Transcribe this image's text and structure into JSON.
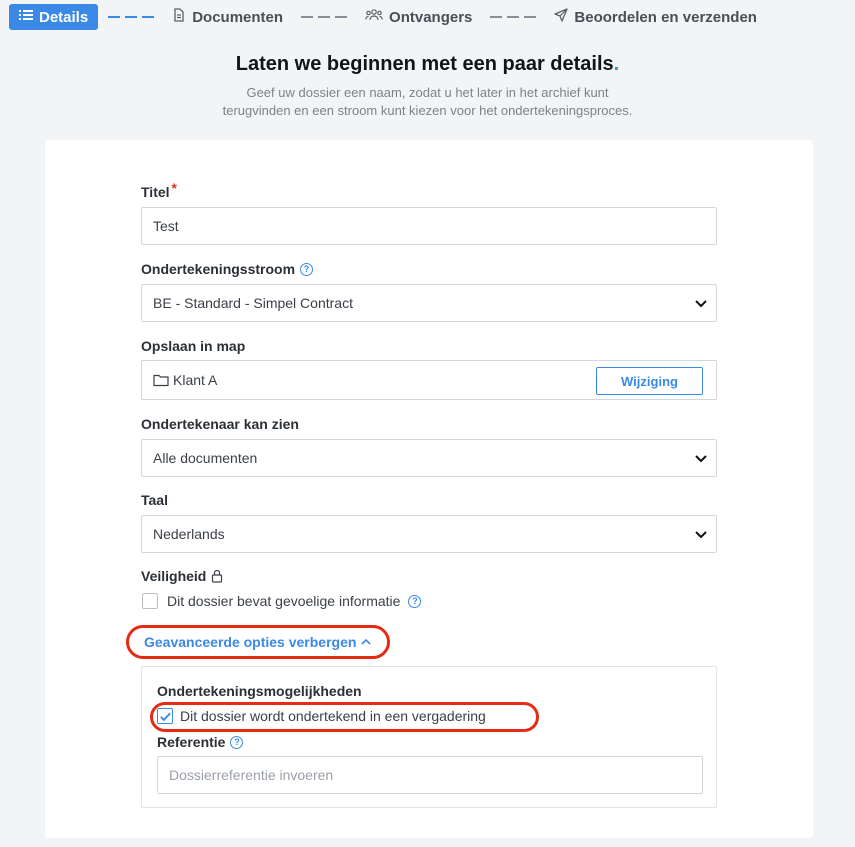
{
  "stepper": {
    "steps": [
      {
        "label": "Details",
        "icon": "list-icon",
        "active": true
      },
      {
        "label": "Documenten",
        "icon": "document-icon"
      },
      {
        "label": "Ontvangers",
        "icon": "users-icon"
      },
      {
        "label": "Beoordelen en verzenden",
        "icon": "send-icon"
      }
    ]
  },
  "header": {
    "title": "Laten we beginnen met een paar details",
    "title_dot": ".",
    "subtitle_line1": "Geef uw dossier een naam, zodat u het later in het archief kunt",
    "subtitle_line2": "terugvinden en een stroom kunt kiezen voor het ondertekeningsproces."
  },
  "form": {
    "title_label": "Titel",
    "title_required": "*",
    "title_value": "Test",
    "flow_label": "Ondertekeningsstroom",
    "flow_value": "BE - Standard - Simpel Contract",
    "folder_label": "Opslaan in map",
    "folder_value": "Klant A",
    "folder_change_button": "Wijziging",
    "signer_sees_label": "Ondertekenaar kan zien",
    "signer_sees_value": "Alle documenten",
    "language_label": "Taal",
    "language_value": "Nederlands",
    "security_label": "Veiligheid",
    "sensitive_checkbox_label": "Dit dossier bevat gevoelige informatie",
    "advanced_toggle": "Geavanceerde opties verbergen",
    "advanced": {
      "signing_options_label": "Ondertekeningsmogelijkheden",
      "meeting_checkbox_label": "Dit dossier wordt ondertekend in een vergadering",
      "meeting_checked": true,
      "reference_label": "Referentie",
      "reference_placeholder": "Dossierreferentie invoeren"
    }
  },
  "colors": {
    "accent": "#3b89e6",
    "highlight": "#e52b14"
  }
}
